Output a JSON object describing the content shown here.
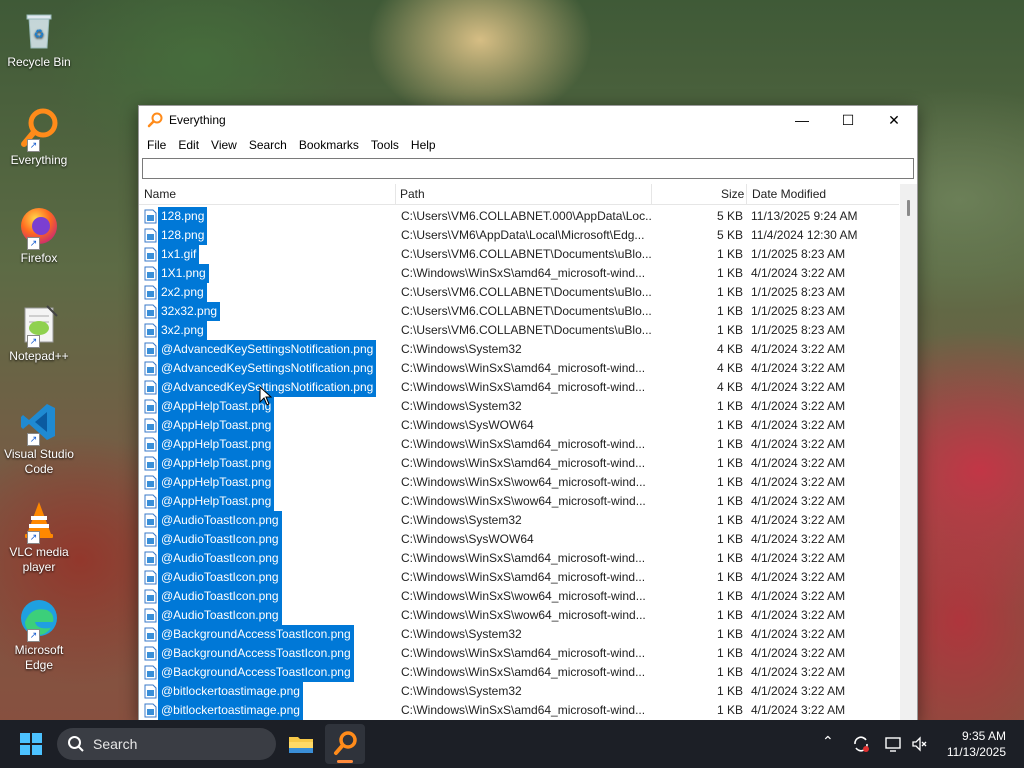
{
  "desktop": {
    "icons": [
      {
        "label": "Recycle Bin",
        "icon": "recycle-bin-icon"
      },
      {
        "label": "Everything",
        "icon": "everything-icon"
      },
      {
        "label": "Firefox",
        "icon": "firefox-icon"
      },
      {
        "label": "Notepad++",
        "icon": "notepadpp-icon"
      },
      {
        "label": "Visual Studio Code",
        "icon": "vscode-icon"
      },
      {
        "label": "VLC media player",
        "icon": "vlc-icon"
      },
      {
        "label": "Microsoft Edge",
        "icon": "edge-icon"
      }
    ]
  },
  "window": {
    "title": "Everything",
    "controls": {
      "minimize": "—",
      "maximize": "☐",
      "close": "✕"
    },
    "menu": [
      "File",
      "Edit",
      "View",
      "Search",
      "Bookmarks",
      "Tools",
      "Help"
    ],
    "search": {
      "value": "",
      "placeholder": ""
    },
    "columns": {
      "name": "Name",
      "path": "Path",
      "size": "Size",
      "date": "Date Modified"
    },
    "rows": [
      {
        "name": "128.png",
        "path": "C:\\Users\\VM6.COLLABNET.000\\AppData\\Loc...",
        "size": "5 KB",
        "date": "11/13/2025 9:24 AM"
      },
      {
        "name": "128.png",
        "path": "C:\\Users\\VM6\\AppData\\Local\\Microsoft\\Edg...",
        "size": "5 KB",
        "date": "11/4/2024 12:30 AM"
      },
      {
        "name": "1x1.gif",
        "path": "C:\\Users\\VM6.COLLABNET\\Documents\\uBlo...",
        "size": "1 KB",
        "date": "1/1/2025 8:23 AM"
      },
      {
        "name": "1X1.png",
        "path": "C:\\Windows\\WinSxS\\amd64_microsoft-wind...",
        "size": "1 KB",
        "date": "4/1/2024 3:22 AM"
      },
      {
        "name": "2x2.png",
        "path": "C:\\Users\\VM6.COLLABNET\\Documents\\uBlo...",
        "size": "1 KB",
        "date": "1/1/2025 8:23 AM"
      },
      {
        "name": "32x32.png",
        "path": "C:\\Users\\VM6.COLLABNET\\Documents\\uBlo...",
        "size": "1 KB",
        "date": "1/1/2025 8:23 AM"
      },
      {
        "name": "3x2.png",
        "path": "C:\\Users\\VM6.COLLABNET\\Documents\\uBlo...",
        "size": "1 KB",
        "date": "1/1/2025 8:23 AM"
      },
      {
        "name": "@AdvancedKeySettingsNotification.png",
        "path": "C:\\Windows\\System32",
        "size": "4 KB",
        "date": "4/1/2024 3:22 AM"
      },
      {
        "name": "@AdvancedKeySettingsNotification.png",
        "path": "C:\\Windows\\WinSxS\\amd64_microsoft-wind...",
        "size": "4 KB",
        "date": "4/1/2024 3:22 AM"
      },
      {
        "name": "@AdvancedKeySettingsNotification.png",
        "path": "C:\\Windows\\WinSxS\\amd64_microsoft-wind...",
        "size": "4 KB",
        "date": "4/1/2024 3:22 AM"
      },
      {
        "name": "@AppHelpToast.png",
        "path": "C:\\Windows\\System32",
        "size": "1 KB",
        "date": "4/1/2024 3:22 AM"
      },
      {
        "name": "@AppHelpToast.png",
        "path": "C:\\Windows\\SysWOW64",
        "size": "1 KB",
        "date": "4/1/2024 3:22 AM"
      },
      {
        "name": "@AppHelpToast.png",
        "path": "C:\\Windows\\WinSxS\\amd64_microsoft-wind...",
        "size": "1 KB",
        "date": "4/1/2024 3:22 AM"
      },
      {
        "name": "@AppHelpToast.png",
        "path": "C:\\Windows\\WinSxS\\amd64_microsoft-wind...",
        "size": "1 KB",
        "date": "4/1/2024 3:22 AM"
      },
      {
        "name": "@AppHelpToast.png",
        "path": "C:\\Windows\\WinSxS\\wow64_microsoft-wind...",
        "size": "1 KB",
        "date": "4/1/2024 3:22 AM"
      },
      {
        "name": "@AppHelpToast.png",
        "path": "C:\\Windows\\WinSxS\\wow64_microsoft-wind...",
        "size": "1 KB",
        "date": "4/1/2024 3:22 AM"
      },
      {
        "name": "@AudioToastIcon.png",
        "path": "C:\\Windows\\System32",
        "size": "1 KB",
        "date": "4/1/2024 3:22 AM"
      },
      {
        "name": "@AudioToastIcon.png",
        "path": "C:\\Windows\\SysWOW64",
        "size": "1 KB",
        "date": "4/1/2024 3:22 AM"
      },
      {
        "name": "@AudioToastIcon.png",
        "path": "C:\\Windows\\WinSxS\\amd64_microsoft-wind...",
        "size": "1 KB",
        "date": "4/1/2024 3:22 AM"
      },
      {
        "name": "@AudioToastIcon.png",
        "path": "C:\\Windows\\WinSxS\\amd64_microsoft-wind...",
        "size": "1 KB",
        "date": "4/1/2024 3:22 AM"
      },
      {
        "name": "@AudioToastIcon.png",
        "path": "C:\\Windows\\WinSxS\\wow64_microsoft-wind...",
        "size": "1 KB",
        "date": "4/1/2024 3:22 AM"
      },
      {
        "name": "@AudioToastIcon.png",
        "path": "C:\\Windows\\WinSxS\\wow64_microsoft-wind...",
        "size": "1 KB",
        "date": "4/1/2024 3:22 AM"
      },
      {
        "name": "@BackgroundAccessToastIcon.png",
        "path": "C:\\Windows\\System32",
        "size": "1 KB",
        "date": "4/1/2024 3:22 AM"
      },
      {
        "name": "@BackgroundAccessToastIcon.png",
        "path": "C:\\Windows\\WinSxS\\amd64_microsoft-wind...",
        "size": "1 KB",
        "date": "4/1/2024 3:22 AM"
      },
      {
        "name": "@BackgroundAccessToastIcon.png",
        "path": "C:\\Windows\\WinSxS\\amd64_microsoft-wind...",
        "size": "1 KB",
        "date": "4/1/2024 3:22 AM"
      },
      {
        "name": "@bitlockertoastimage.png",
        "path": "C:\\Windows\\System32",
        "size": "1 KB",
        "date": "4/1/2024 3:22 AM"
      },
      {
        "name": "@bitlockertoastimage.png",
        "path": "C:\\Windows\\WinSxS\\amd64_microsoft-wind...",
        "size": "1 KB",
        "date": "4/1/2024 3:22 AM"
      }
    ]
  },
  "taskbar": {
    "search_label": "Search",
    "time": "9:35 AM",
    "date": "11/13/2025",
    "accent_color": "#ff8b3d"
  },
  "colors": {
    "selection": "#0078d7"
  }
}
